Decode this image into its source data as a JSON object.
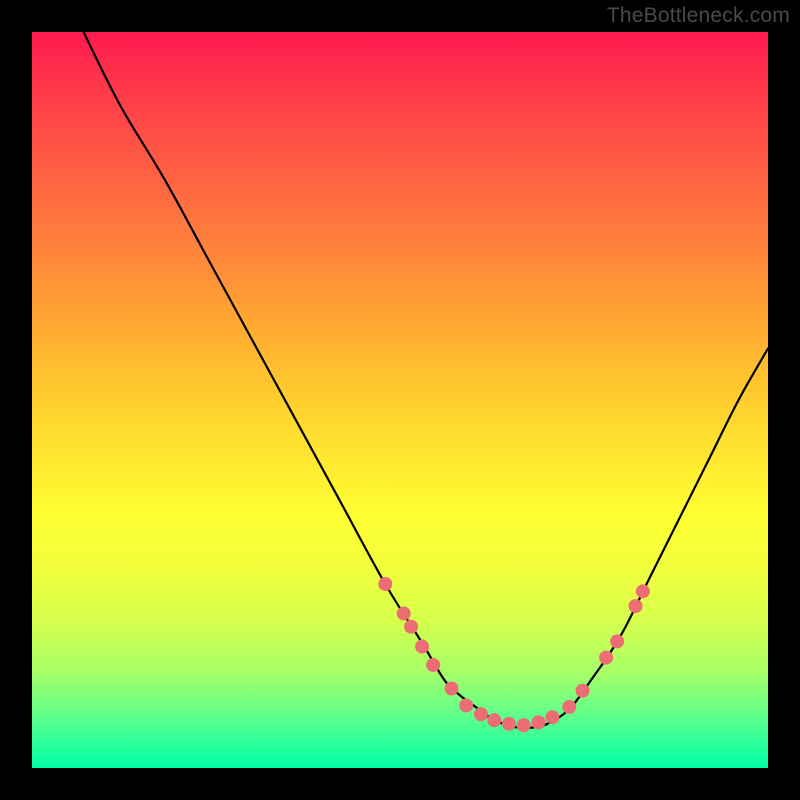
{
  "watermark": "TheBottleneck.com",
  "chart_data": {
    "type": "line",
    "title": "",
    "xlabel": "",
    "ylabel": "",
    "xlim": [
      0,
      100
    ],
    "ylim": [
      0,
      100
    ],
    "series": [
      {
        "name": "curve",
        "color": "#000000",
        "x": [
          7,
          12,
          18,
          24,
          30,
          36,
          42,
          48,
          53,
          56,
          58,
          60,
          62,
          64,
          66,
          68,
          70,
          73,
          76,
          80,
          84,
          88,
          92,
          96,
          100
        ],
        "y": [
          100,
          90,
          80,
          69,
          58,
          47,
          36,
          25,
          17,
          12,
          10,
          8.5,
          7,
          6,
          5.5,
          5.5,
          6,
          8,
          12,
          18,
          26,
          34,
          42,
          50,
          57
        ]
      }
    ],
    "markers": [
      {
        "x": 48.0,
        "y": 25.0
      },
      {
        "x": 50.5,
        "y": 21.0
      },
      {
        "x": 51.5,
        "y": 19.2
      },
      {
        "x": 53.0,
        "y": 16.5
      },
      {
        "x": 54.5,
        "y": 14.0
      },
      {
        "x": 57.0,
        "y": 10.8
      },
      {
        "x": 59.0,
        "y": 8.5
      },
      {
        "x": 61.0,
        "y": 7.3
      },
      {
        "x": 62.8,
        "y": 6.5
      },
      {
        "x": 64.8,
        "y": 6.0
      },
      {
        "x": 66.8,
        "y": 5.8
      },
      {
        "x": 68.8,
        "y": 6.2
      },
      {
        "x": 70.7,
        "y": 6.9
      },
      {
        "x": 73.0,
        "y": 8.3
      },
      {
        "x": 74.8,
        "y": 10.5
      },
      {
        "x": 78.0,
        "y": 15.0
      },
      {
        "x": 79.5,
        "y": 17.2
      },
      {
        "x": 82.0,
        "y": 22.0
      },
      {
        "x": 83.0,
        "y": 24.0
      }
    ],
    "marker_style": {
      "color": "#ec6d74",
      "radius_px": 7
    },
    "gradient_stops": [
      {
        "offset": 0.0,
        "color": "#ff1a50"
      },
      {
        "offset": 0.5,
        "color": "#ffd92f"
      },
      {
        "offset": 1.0,
        "color": "#00ffa8"
      }
    ]
  }
}
